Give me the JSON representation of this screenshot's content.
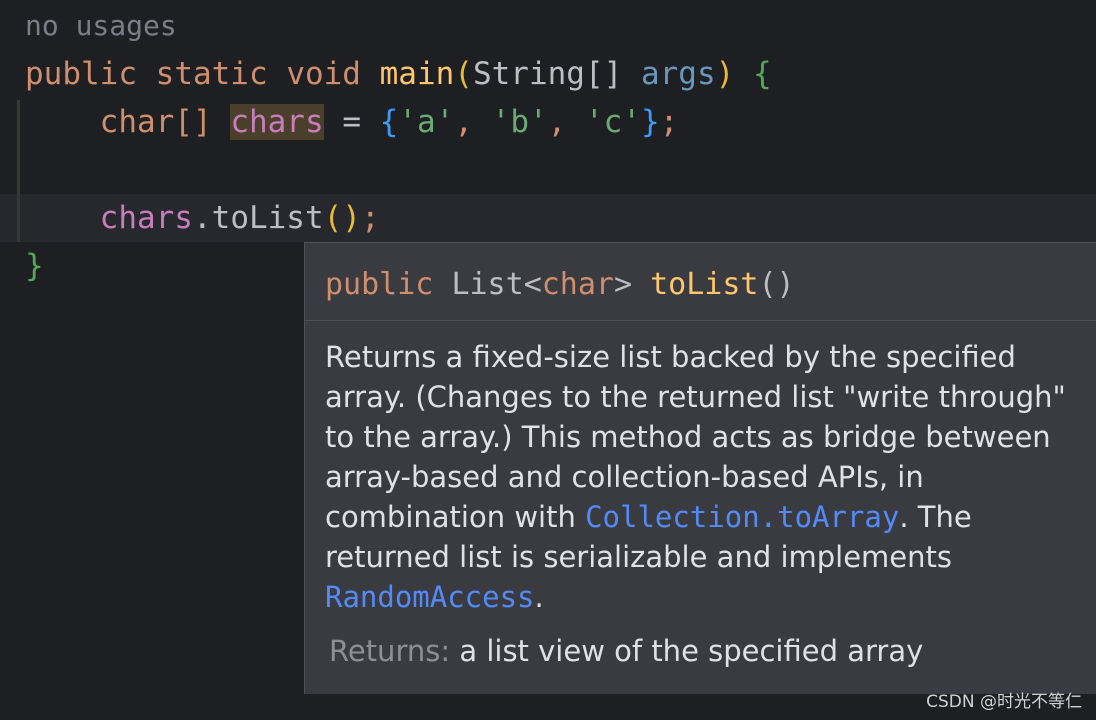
{
  "editor": {
    "hint": "no usages",
    "line1": {
      "kw_public": "public",
      "kw_static": "static",
      "kw_void": "void",
      "method": "main",
      "paren_open": "(",
      "param_type": "String[]",
      "param_name": "args",
      "paren_close": ")",
      "brace_open": "{"
    },
    "line2": {
      "type": "char[]",
      "var": "chars",
      "eq": "=",
      "brace_open": "{",
      "val1": "'a'",
      "comma1": ",",
      "val2": "'b'",
      "comma2": ",",
      "val3": "'c'",
      "brace_close": "}",
      "semi": ";"
    },
    "line4": {
      "var": "chars",
      "dot": ".",
      "method": "toList",
      "parens": "()",
      "semi": ";"
    },
    "closing_brace": "}"
  },
  "doc": {
    "signature": {
      "kw": "public",
      "ret_type": "List",
      "lt": "<",
      "generic": "char",
      "gt": ">",
      "name": "toList",
      "parens": "()"
    },
    "text_before_link1": "Returns a fixed-size list backed by the specified array. (Changes to the returned list \"write through\" to the array.) This method acts as bridge between array-based and collection-based APIs, in combination with ",
    "link1": "Collection.toArray",
    "text_after_link1": ". The returned list is serializable and implements ",
    "link2": "RandomAccess",
    "text_end": ".",
    "returns_label": "Returns:",
    "returns_text": "a list view of the specified array"
  },
  "watermark": "CSDN @时光不等仁",
  "colors": {
    "background": "#1e1f22",
    "popup": "#393b40",
    "keyword": "#cf8e6d",
    "link": "#548af7"
  }
}
